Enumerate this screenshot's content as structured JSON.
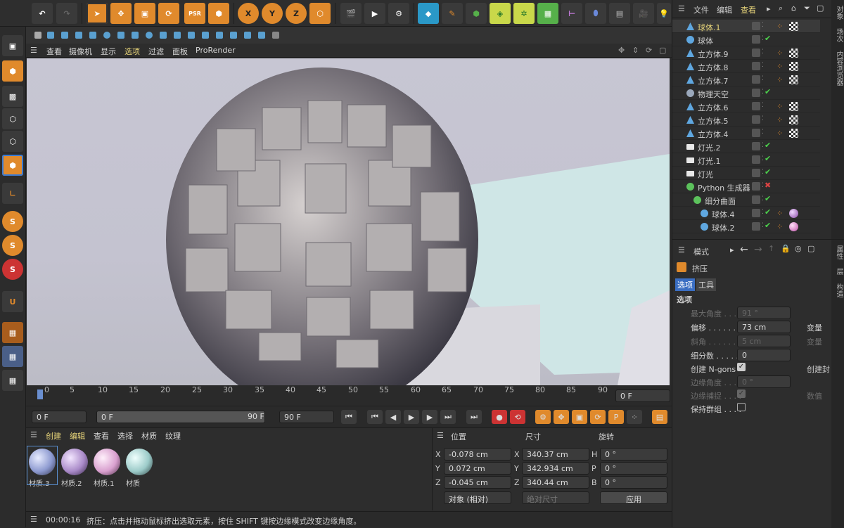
{
  "viewport_menu": {
    "items": [
      "查看",
      "摄像机",
      "显示",
      "选项",
      "过滤",
      "面板",
      "ProRender"
    ],
    "active_index": 3
  },
  "axes": {
    "x": "X",
    "y": "Y",
    "z": "Z"
  },
  "toolbar_icons": [
    "undo-icon",
    "redo-icon",
    "select-icon",
    "move-icon",
    "scale-icon",
    "rotate-icon",
    "psr-icon",
    "cube-icon",
    "axis-x-icon",
    "axis-y-icon",
    "axis-z-icon",
    "coord-system-icon",
    "render-view-icon",
    "render-icon",
    "render-settings-icon",
    "cube-primitive-icon",
    "pen-icon",
    "subdivision-icon",
    "box-deformer-icon",
    "mograph-icon",
    "cloner-icon",
    "scene-icon",
    "floor-icon",
    "camera-icon",
    "light-icon"
  ],
  "timeline": {
    "ticks": [
      "0",
      "5",
      "10",
      "15",
      "20",
      "25",
      "30",
      "35",
      "40",
      "45",
      "50",
      "55",
      "60",
      "65",
      "70",
      "75",
      "80",
      "85",
      "90"
    ],
    "current_frame": "0 F"
  },
  "playback": {
    "start": "0 F",
    "range_start": "0 F",
    "range_end": "90 F",
    "end": "90 F"
  },
  "materials": {
    "menu": [
      "创建",
      "编辑",
      "查看",
      "选择",
      "材质",
      "纹理"
    ],
    "items": [
      {
        "name": "材质.3",
        "color": "#8d9ad0"
      },
      {
        "name": "材质.2",
        "color": "#a98ac8"
      },
      {
        "name": "材质.1",
        "color": "#d9a0cf"
      },
      {
        "name": "材质",
        "color": "#9ccbc9"
      }
    ]
  },
  "coords": {
    "headers": [
      "位置",
      "尺寸",
      "旋转"
    ],
    "rows": [
      {
        "axis": "X",
        "pos": "-0.078 cm",
        "size_axis": "X",
        "size": "340.37 cm",
        "rot_axis": "H",
        "rot": "0 °"
      },
      {
        "axis": "Y",
        "pos": "0.072 cm",
        "size_axis": "Y",
        "size": "342.934 cm",
        "rot_axis": "P",
        "rot": "0 °"
      },
      {
        "axis": "Z",
        "pos": "-0.045 cm",
        "size_axis": "Z",
        "size": "340.44 cm",
        "rot_axis": "B",
        "rot": "0 °"
      }
    ],
    "mode": "对象 (相对)",
    "size_mode": "绝对尺寸",
    "apply": "应用"
  },
  "status": {
    "time": "00:00:16",
    "text": "挤压：点击并拖动鼠标挤出选取元素，按住 SHIFT 键按边缘模式改变边缘角度。"
  },
  "object_manager": {
    "menu": [
      "文件",
      "编辑",
      "查看"
    ],
    "side_tabs": [
      "对象",
      "场次",
      "内容浏览器"
    ],
    "objects": [
      {
        "name": "球体.1",
        "icon": "sphere-cone",
        "color": "#5fa7e0",
        "indent": 0,
        "tag": "checker",
        "highlight": true
      },
      {
        "name": "球体",
        "icon": "sphere",
        "color": "#5fa7e0",
        "indent": 0,
        "tag": "none",
        "check": true
      },
      {
        "name": "立方体.9",
        "icon": "cone",
        "color": "#5fa7e0",
        "indent": 0,
        "tag": "checker"
      },
      {
        "name": "立方体.8",
        "icon": "cone",
        "color": "#5fa7e0",
        "indent": 0,
        "tag": "checker"
      },
      {
        "name": "立方体.7",
        "icon": "cone",
        "color": "#5fa7e0",
        "indent": 0,
        "tag": "checker"
      },
      {
        "name": "物理天空",
        "icon": "sky",
        "color": "#9aa8bb",
        "indent": 0,
        "tag": "none",
        "check": true
      },
      {
        "name": "立方体.6",
        "icon": "cone",
        "color": "#5fa7e0",
        "indent": 0,
        "tag": "checker"
      },
      {
        "name": "立方体.5",
        "icon": "cone",
        "color": "#5fa7e0",
        "indent": 0,
        "tag": "checker"
      },
      {
        "name": "立方体.4",
        "icon": "cone",
        "color": "#5fa7e0",
        "indent": 0,
        "tag": "checker"
      },
      {
        "name": "灯光.2",
        "icon": "light",
        "color": "#e8e8e8",
        "indent": 0,
        "tag": "none",
        "check": true
      },
      {
        "name": "灯光.1",
        "icon": "light",
        "color": "#e8e8e8",
        "indent": 0,
        "tag": "none",
        "check": true
      },
      {
        "name": "灯光",
        "icon": "light",
        "color": "#e8e8e8",
        "indent": 0,
        "tag": "none",
        "check": true
      },
      {
        "name": "Python 生成器",
        "icon": "python",
        "color": "#5cc25c",
        "indent": 0,
        "tag": "none",
        "cross": true
      },
      {
        "name": "细分曲面",
        "icon": "subdiv",
        "color": "#5cc25c",
        "indent": 1,
        "tag": "none",
        "check": true
      },
      {
        "name": "球体.4",
        "icon": "sphere",
        "color": "#5fa7e0",
        "indent": 2,
        "tag": "material",
        "check": true
      },
      {
        "name": "球体.2",
        "icon": "sphere",
        "color": "#5fa7e0",
        "indent": 2,
        "tag": "material2",
        "check": true
      }
    ]
  },
  "attributes": {
    "mode_label": "模式",
    "side_tabs": [
      "属性",
      "层",
      "构造"
    ],
    "object_name": "挤压",
    "tabs": [
      "选项",
      "工具"
    ],
    "section": "选项",
    "fields": [
      {
        "label": "最大角度 . . .",
        "value": "91 °",
        "disabled": true
      },
      {
        "label": "偏移 . . . . . . .",
        "value": "73 cm",
        "disabled": false,
        "right": "变量"
      },
      {
        "label": "斜角 . . . . . . .",
        "value": "5 cm",
        "disabled": true,
        "right": "变量"
      },
      {
        "label": "细分数 . . . . .",
        "value": "0",
        "disabled": false
      },
      {
        "label": "创建 N-gons",
        "value": "",
        "checkbox": true,
        "checked": true,
        "disabled": false,
        "right": "创建封"
      },
      {
        "label": "边缘角度 . . . .",
        "value": "0 °",
        "disabled": true
      },
      {
        "label": "边缘捕捉 . . . .",
        "value": "",
        "checkbox": true,
        "checked": true,
        "disabled": true,
        "right": "数值"
      },
      {
        "label": "保持群组 . . . .",
        "value": "",
        "checkbox": true,
        "checked": false,
        "disabled": false
      }
    ]
  }
}
